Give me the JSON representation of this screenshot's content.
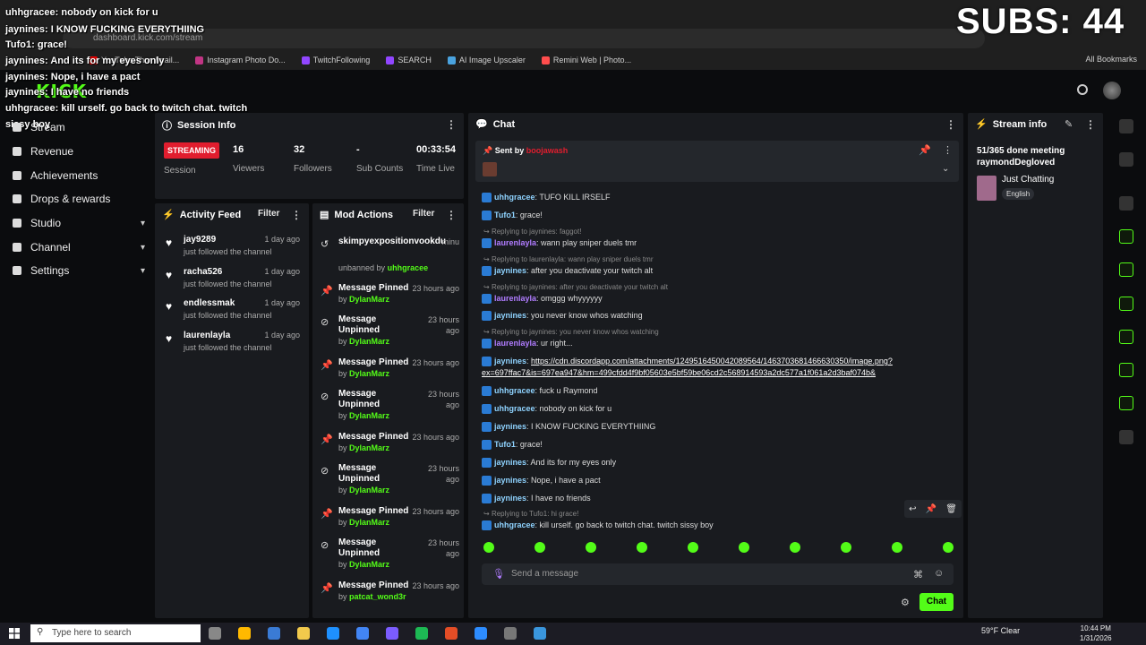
{
  "browser": {
    "url": "dashboard.kick.com/stream",
    "bookmarks": [
      "YouTube Thumbnail...",
      "Instagram Photo Do...",
      "TwitchFollowing",
      "SEARCH",
      "AI Image Upscaler",
      "Remini Web | Photo..."
    ],
    "all_bookmarks": "All Bookmarks"
  },
  "overlay": {
    "subs": "SUBS: 44",
    "lines": [
      {
        "user": "uhhgracee",
        "text": "nobody on kick for u"
      },
      {
        "user": "jaynines",
        "text": "I KNOW FUCKING EVERYTHIING"
      },
      {
        "user": "Tufo1",
        "text": "grace!"
      },
      {
        "user": "jaynines",
        "text": "And its for my eyes only"
      },
      {
        "user": "jaynines",
        "text": "Nope, i have a pact"
      },
      {
        "user": "jaynines",
        "text": "I have no friends"
      },
      {
        "user": "uhhgracee",
        "text": "kill urself. go back to twitch chat. twitch"
      },
      {
        "user": "",
        "text": "sissy boy"
      }
    ]
  },
  "sidebar": {
    "items": [
      {
        "label": "Stream",
        "icon": "video-icon"
      },
      {
        "label": "Revenue",
        "icon": "dollar-icon"
      },
      {
        "label": "Achievements",
        "icon": "trophy-icon"
      },
      {
        "label": "Drops & rewards",
        "icon": "gift-icon"
      },
      {
        "label": "Studio",
        "icon": "monitor-icon",
        "chevron": "▾"
      },
      {
        "label": "Channel",
        "icon": "channel-icon",
        "chevron": "▾"
      },
      {
        "label": "Settings",
        "icon": "gear-icon",
        "chevron": "▾"
      }
    ]
  },
  "session": {
    "title": "Session Info",
    "status": "STREAMING",
    "status_label": "Session",
    "stats": [
      {
        "value": "16",
        "label": "Viewers"
      },
      {
        "value": "32",
        "label": "Followers"
      },
      {
        "value": "-",
        "label": "Sub Counts"
      },
      {
        "value": "00:33:54",
        "label": "Time Live"
      }
    ]
  },
  "activity": {
    "title": "Activity Feed",
    "filter": "Filter",
    "items": [
      {
        "name": "jay9289",
        "sub": "just followed the channel",
        "time": "1 day ago"
      },
      {
        "name": "racha526",
        "sub": "just followed the channel",
        "time": "1 day ago"
      },
      {
        "name": "endlessmak",
        "sub": "just followed the channel",
        "time": "1 day ago"
      },
      {
        "name": "laurenlayla",
        "sub": "just followed the channel",
        "time": "1 day ago"
      }
    ]
  },
  "mod": {
    "title": "Mod Actions",
    "filter": "Filter",
    "first": {
      "name": "skimpyexpositionvookdu",
      "time": "minu",
      "by_prefix": "unbanned by",
      "by": "uhhgracee"
    },
    "items": [
      {
        "action": "Message Pinned",
        "time": "23 hours ago",
        "by": "DylanMarz"
      },
      {
        "action": "Message Unpinned",
        "time": "23 hours ago",
        "by": "DylanMarz"
      },
      {
        "action": "Message Pinned",
        "time": "23 hours ago",
        "by": "DylanMarz"
      },
      {
        "action": "Message Unpinned",
        "time": "23 hours ago",
        "by": "DylanMarz"
      },
      {
        "action": "Message Pinned",
        "time": "23 hours ago",
        "by": "DylanMarz"
      },
      {
        "action": "Message Unpinned",
        "time": "23 hours ago",
        "by": "DylanMarz"
      },
      {
        "action": "Message Pinned",
        "time": "23 hours ago",
        "by": "DylanMarz"
      },
      {
        "action": "Message Unpinned",
        "time": "23 hours ago",
        "by": "DylanMarz"
      },
      {
        "action": "Message Pinned",
        "time": "23 hours ago",
        "by": "patcat_wond3r"
      }
    ],
    "by_prefix": "by"
  },
  "chat": {
    "title": "Chat",
    "pinned_label": "Sent by",
    "pinned_user": "boojawash",
    "messages": [
      {
        "reply": "",
        "user": "uhhgracee",
        "color": "#8fd3ff",
        "text": "TUFO KILL IRSELF"
      },
      {
        "reply": "",
        "user": "Tufo1",
        "color": "#8fd3ff",
        "text": "grace!"
      },
      {
        "reply": "Replying to jaynines: faggot!",
        "user": "laurenlayla",
        "color": "#b07cff",
        "text": "wann play sniper duels tmr"
      },
      {
        "reply": "Replying to laurenlayla: wann play sniper duels tmr",
        "user": "jaynines",
        "color": "#8fd3ff",
        "text": "after you deactivate your twitch alt"
      },
      {
        "reply": "Replying to jaynines: after you deactivate your twitch alt",
        "user": "laurenlayla",
        "color": "#b07cff",
        "text": "omggg whyyyyyy"
      },
      {
        "reply": "",
        "user": "jaynines",
        "color": "#8fd3ff",
        "text": "you never know whos watching"
      },
      {
        "reply": "Replying to jaynines: you never know whos watching",
        "user": "laurenlayla",
        "color": "#b07cff",
        "text": "ur right..."
      },
      {
        "reply": "",
        "user": "jaynines",
        "color": "#8fd3ff",
        "text": "https://cdn.discordapp.com/attachments/1249516450042089564/1463703681466630350/image.png?"
      },
      {
        "reply": "",
        "user": "",
        "color": "#8fd3ff",
        "text": "ex=697ffac7&is=697ea947&hm=499cfdd4f9bf05603e5bf59be06cd2c568914593a2dc577a1f061a2d3baf074b&"
      },
      {
        "reply": "",
        "user": "uhhgracee",
        "color": "#8fd3ff",
        "text": "fuck u Raymond"
      },
      {
        "reply": "",
        "user": "uhhgracee",
        "color": "#8fd3ff",
        "text": "nobody on kick for u"
      },
      {
        "reply": "",
        "user": "jaynines",
        "color": "#8fd3ff",
        "text": "I KNOW FUCKING EVERYTHIING"
      },
      {
        "reply": "",
        "user": "Tufo1",
        "color": "#8fd3ff",
        "text": "grace!"
      },
      {
        "reply": "",
        "user": "jaynines",
        "color": "#8fd3ff",
        "text": "And its for my eyes only"
      },
      {
        "reply": "",
        "user": "jaynines",
        "color": "#8fd3ff",
        "text": "Nope, i have a pact"
      },
      {
        "reply": "",
        "user": "jaynines",
        "color": "#8fd3ff",
        "text": "I have no friends"
      },
      {
        "reply": "Replying to Tufo1: hi grace!",
        "user": "uhhgracee",
        "color": "#8fd3ff",
        "text": "kill urself. go back to twitch chat. twitch sissy boy"
      }
    ],
    "placeholder": "Send a message",
    "send": "Chat"
  },
  "stream_info": {
    "title": "Stream info",
    "stream_title": "51/365 done meeting raymondDegloved",
    "category": "Just Chatting",
    "language": "English"
  },
  "taskbar": {
    "search_placeholder": "Type here to search",
    "weather": "59°F Clear",
    "time": "10:44 PM",
    "date": "1/31/2026"
  },
  "colors": {
    "accent": "#53fc18",
    "live": "#e11d2e",
    "panel": "#191b1f"
  }
}
